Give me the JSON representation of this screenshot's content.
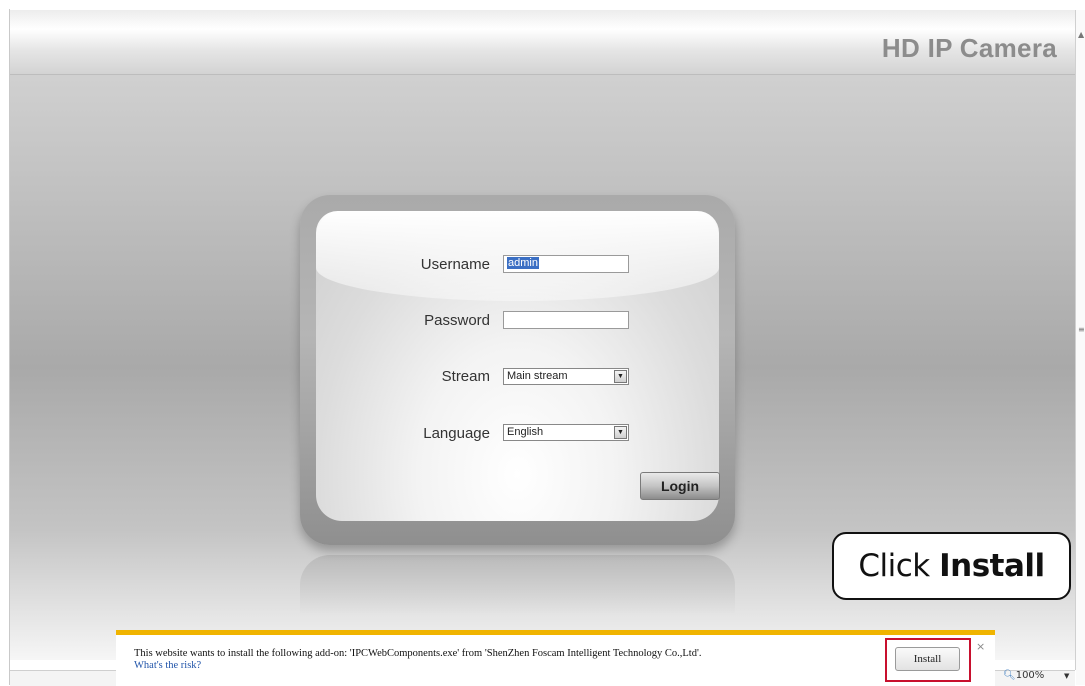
{
  "header": {
    "brand": "HD IP Camera"
  },
  "login": {
    "username_label": "Username",
    "username_value": "admin",
    "password_label": "Password",
    "password_value": "",
    "stream_label": "Stream",
    "stream_value": "Main stream",
    "language_label": "Language",
    "language_value": "English",
    "login_button": "Login"
  },
  "callout": {
    "prefix": "Click ",
    "emphasis": "Install"
  },
  "infobar": {
    "message": "This website wants to install the following add-on: 'IPCWebComponents.exe' from 'ShenZhen Foscam Intelligent Technology Co.,Ltd'.",
    "risk_link": "What's the risk?",
    "install_button": "Install",
    "close_glyph": "×"
  },
  "statusbar": {
    "zoom": "100%"
  },
  "icons": {
    "dropdown": "▼",
    "zoom": "🔍︎",
    "zoom_menu": "▼"
  },
  "colors": {
    "infobar_accent": "#f0b400",
    "highlight": "#c8102e",
    "selection": "#3b6fc4"
  }
}
